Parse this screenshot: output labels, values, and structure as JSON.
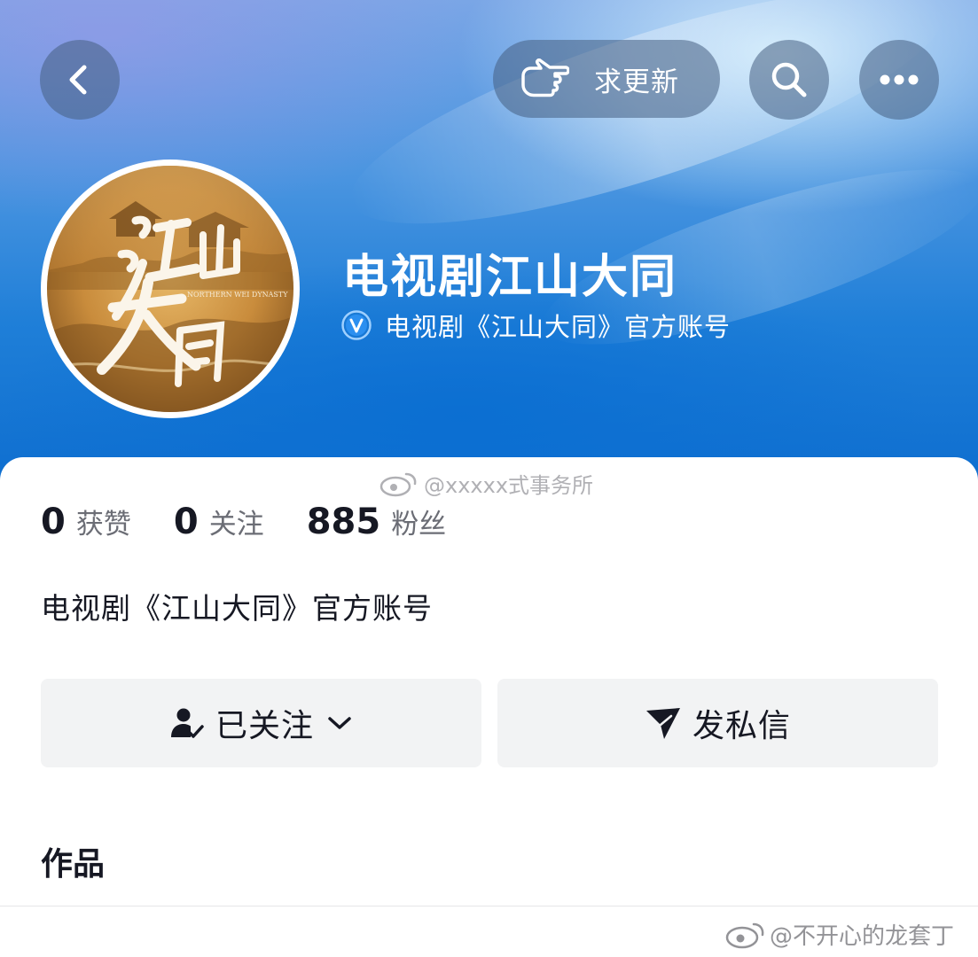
{
  "topbar": {
    "request_update_label": "求更新"
  },
  "profile": {
    "name": "电视剧江山大同",
    "verification": "电视剧《江山大同》官方账号",
    "avatar_art_text": [
      "江山",
      "大同"
    ],
    "avatar_subtitle": "NORTHERN WEI DYNASTY"
  },
  "stats": [
    {
      "value": "0",
      "label": "获赞"
    },
    {
      "value": "0",
      "label": "关注"
    },
    {
      "value": "885",
      "label": "粉丝"
    }
  ],
  "bio": "电视剧《江山大同》官方账号",
  "actions": {
    "follow_label": "已关注",
    "message_label": "发私信"
  },
  "tabs": {
    "works_label": "作品"
  },
  "watermarks": {
    "center": "@xxxxx式事务所",
    "bottom_right": "@不开心的龙套丁"
  },
  "colors": {
    "header_blue": "#1f7fd8",
    "button_bg": "#f2f3f4",
    "text": "#161823",
    "muted": "#6b6d75"
  }
}
